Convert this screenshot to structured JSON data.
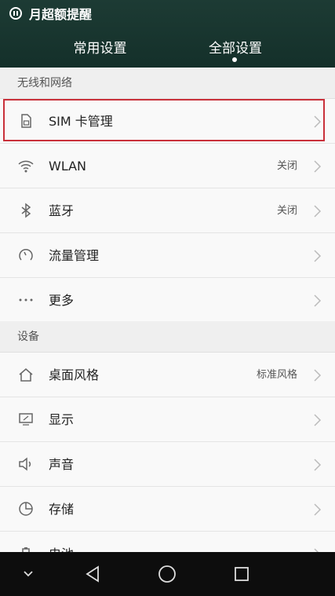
{
  "status_bar": {
    "notification_text": "月超额提醒",
    "notification_icon": "pause-circle-icon"
  },
  "tabs": [
    {
      "label": "常用设置",
      "active": false
    },
    {
      "label": "全部设置",
      "active": true
    }
  ],
  "sections": [
    {
      "title": "无线和网络",
      "items": [
        {
          "label": "SIM 卡管理",
          "value": "",
          "icon": "sim-card-icon",
          "highlighted": true
        },
        {
          "label": "WLAN",
          "value": "关闭",
          "icon": "wifi-icon"
        },
        {
          "label": "蓝牙",
          "value": "关闭",
          "icon": "bluetooth-icon"
        },
        {
          "label": "流量管理",
          "value": "",
          "icon": "data-usage-icon"
        },
        {
          "label": "更多",
          "value": "",
          "icon": "more-icon"
        }
      ]
    },
    {
      "title": "设备",
      "items": [
        {
          "label": "桌面风格",
          "value": "标准风格",
          "icon": "home-icon"
        },
        {
          "label": "显示",
          "value": "",
          "icon": "display-icon"
        },
        {
          "label": "声音",
          "value": "",
          "icon": "speaker-icon"
        },
        {
          "label": "存储",
          "value": "",
          "icon": "storage-icon"
        },
        {
          "label": "电池",
          "value": "",
          "icon": "battery-icon"
        }
      ]
    }
  ],
  "nav_bar": [
    "chevron-down-icon",
    "back-icon",
    "home-circle-icon",
    "recents-icon"
  ],
  "colors": {
    "header": "#1d3b34",
    "highlight": "#c9303a",
    "nav": "#0d0d0d"
  }
}
